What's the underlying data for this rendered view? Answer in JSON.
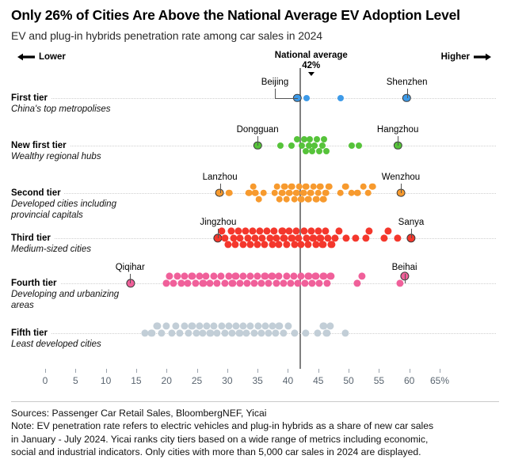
{
  "header": {
    "title": "Only 26% of Cities Are Above the National Average EV Adoption Level",
    "subtitle": "EV and plug-in hybrids penetration rate among car sales in 2024",
    "lower_label": "Lower",
    "higher_label": "Higher",
    "national_average_label": "National average",
    "national_average_value": "42%"
  },
  "footer": {
    "sources": "Sources: Passenger Car Retail Sales, BloombergNEF, Yicai",
    "note_line1": "Note: EV penetration rate refers to electric vehicles and plug-in hybrids as a share of new car sales",
    "note_line2": "in January - July 2024. Yicai ranks city tiers based on a wide range of metrics including economic,",
    "note_line3": "social and industrial indicators. Only cities with more than 5,000 car sales in 2024 are displayed."
  },
  "chart_data": {
    "type": "scatter",
    "title": "Only 26% of Cities Are Above the National Average EV Adoption Level",
    "subtitle": "EV and plug-in hybrids penetration rate among car sales in 2024",
    "xlabel": "",
    "ylabel": "",
    "xlim": [
      0,
      65
    ],
    "grid": false,
    "legend": "none",
    "xticks": [
      0,
      5,
      10,
      15,
      20,
      25,
      30,
      35,
      40,
      45,
      50,
      55,
      60
    ],
    "xticklabels": [
      "0",
      "5",
      "10",
      "15",
      "20",
      "25",
      "30",
      "35",
      "40",
      "45",
      "50",
      "55",
      "60",
      "65%"
    ],
    "reference_line": {
      "label": "National average",
      "value": 42,
      "value_label": "42%"
    },
    "colors": {
      "first_tier": "#3d9ae8",
      "new_first_tier": "#56c33a",
      "second_tier": "#f79a2e",
      "third_tier": "#f4372c",
      "fourth_tier": "#f0609a",
      "fifth_tier": "#c2ced7",
      "reference_line": "#808080",
      "highlight_ring": "#3a3a3a"
    },
    "series": [
      {
        "name": "First tier",
        "description": "China's top metropolises",
        "color": "#3d9ae8",
        "values": [
          41.5,
          43.2,
          48.7,
          59.6
        ],
        "highlights": [
          {
            "city": "Beijing",
            "value": 41.5,
            "callout": "left-elbow"
          },
          {
            "city": "Shenzhen",
            "value": 59.6,
            "callout": "stem"
          }
        ]
      },
      {
        "name": "New first tier",
        "description": "Wealthy regional hubs",
        "color": "#56c33a",
        "values": [
          35.0,
          38.7,
          40.6,
          41.5,
          42.3,
          42.6,
          43.0,
          43.4,
          43.6,
          44.0,
          44.4,
          44.8,
          45.2,
          45.6,
          46.0,
          46.4,
          50.5,
          51.6,
          58.1
        ],
        "highlights": [
          {
            "city": "Dongguan",
            "value": 35.0,
            "callout": "stem"
          },
          {
            "city": "Hangzhou",
            "value": 58.1,
            "callout": "stem"
          }
        ]
      },
      {
        "name": "Second tier",
        "description": "Developed cities including provincial capitals",
        "color": "#f79a2e",
        "values": [
          28.8,
          30.3,
          33.6,
          34.2,
          34.6,
          35.2,
          36.0,
          37.8,
          38.2,
          38.6,
          39.0,
          39.4,
          39.8,
          40.2,
          40.6,
          41.0,
          41.4,
          41.8,
          42.2,
          42.6,
          43.0,
          43.4,
          43.8,
          44.2,
          44.6,
          45.0,
          45.4,
          45.8,
          46.2,
          46.8,
          48.6,
          49.6,
          50.5,
          51.5,
          52.4,
          53.2,
          53.9,
          58.6
        ],
        "highlights": [
          {
            "city": "Lanzhou",
            "value": 28.8,
            "callout": "stem"
          },
          {
            "city": "Wenzhou",
            "value": 58.6,
            "callout": "stem"
          }
        ]
      },
      {
        "name": "Third tier",
        "description": "Medium-sized cities",
        "color": "#f4372c",
        "values": [
          28.5,
          29.1,
          29.6,
          30.1,
          30.6,
          31.0,
          31.4,
          31.8,
          32.2,
          32.6,
          33.0,
          33.4,
          33.8,
          34.2,
          34.6,
          35.0,
          35.4,
          35.8,
          36.2,
          36.6,
          37.0,
          37.4,
          37.8,
          38.2,
          38.6,
          39.0,
          39.4,
          39.8,
          40.2,
          40.6,
          41.0,
          41.4,
          41.8,
          42.2,
          42.6,
          43.0,
          43.4,
          43.8,
          44.2,
          44.6,
          45.0,
          45.4,
          45.8,
          46.2,
          46.6,
          47.2,
          47.8,
          48.4,
          49.6,
          51.2,
          52.8,
          53.4,
          55.8,
          56.4,
          58.0,
          60.3
        ],
        "highlights": [
          {
            "city": "Jingzhou",
            "value": 28.5,
            "callout": "stem"
          },
          {
            "city": "Sanya",
            "value": 60.3,
            "callout": "stem"
          }
        ]
      },
      {
        "name": "Fourth tier",
        "description": "Developing and urbanizing areas",
        "color": "#f0609a",
        "values": [
          14.0,
          20.0,
          20.6,
          21.2,
          21.8,
          22.4,
          23.0,
          23.6,
          24.2,
          24.8,
          25.4,
          26.0,
          26.6,
          27.2,
          27.8,
          28.4,
          29.0,
          29.6,
          30.2,
          30.8,
          31.4,
          32.0,
          32.6,
          33.2,
          33.8,
          34.4,
          35.0,
          35.6,
          36.2,
          36.8,
          37.4,
          38.0,
          38.6,
          39.2,
          39.8,
          40.4,
          41.0,
          41.6,
          42.2,
          42.8,
          43.4,
          44.0,
          44.6,
          45.2,
          45.8,
          46.4,
          47.0,
          51.5,
          52.2,
          58.5,
          59.2
        ],
        "highlights": [
          {
            "city": "Qiqihar",
            "value": 14.0,
            "callout": "stem"
          },
          {
            "city": "Beihai",
            "value": 59.2,
            "callout": "stem"
          }
        ]
      },
      {
        "name": "Fifth tier",
        "description": "Least developed cities",
        "color": "#c2ced7",
        "values": [
          16.5,
          17.6,
          18.4,
          19.2,
          20.0,
          20.8,
          21.5,
          22.2,
          22.9,
          23.6,
          24.2,
          24.8,
          25.4,
          26.0,
          26.6,
          27.2,
          27.8,
          28.4,
          29.0,
          29.6,
          30.2,
          30.8,
          31.4,
          32.0,
          32.6,
          33.2,
          33.8,
          34.4,
          35.0,
          35.6,
          36.2,
          36.8,
          37.4,
          38.0,
          38.6,
          39.2,
          40.0,
          41.0,
          43.0,
          45.0,
          45.8,
          46.4,
          47.0,
          49.5
        ],
        "highlights": []
      }
    ]
  }
}
